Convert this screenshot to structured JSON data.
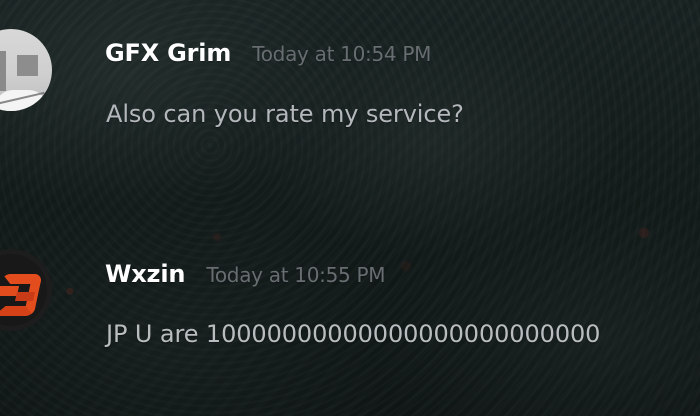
{
  "messages": [
    {
      "username": "GFX Grim",
      "timestamp": "Today at 10:54 PM",
      "text": "Also can you rate my service?",
      "avatar_icon": "gfx-grim-avatar-icon"
    },
    {
      "username": "Wxzin",
      "timestamp": "Today at 10:55 PM",
      "text": "JP U are 10000000000000000000000000",
      "avatar_icon": "wxzin-avatar-icon"
    }
  ],
  "colors": {
    "username": "#ffffff",
    "timestamp": "#686d71",
    "message_text": "#b4b8bc",
    "background": "#1a2524",
    "accent": "#e34d1e"
  }
}
